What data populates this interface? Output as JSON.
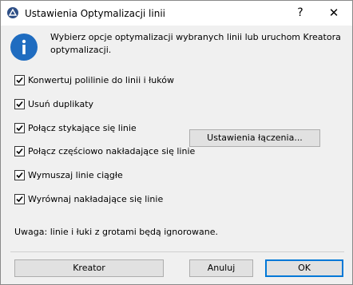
{
  "window": {
    "title": "Ustawienia Optymalizacji linii",
    "help_label": "?",
    "close_label": "✕"
  },
  "intro": {
    "icon": "info-icon",
    "text": "Wybierz opcje optymalizacji wybranych linii lub uruchom Kreatora optymalizacji."
  },
  "options": [
    {
      "label": "Konwertuj polilinie do linii i łuków",
      "checked": true
    },
    {
      "label": "Usuń duplikaty",
      "checked": true
    },
    {
      "label": "Połącz stykające się linie",
      "checked": true
    },
    {
      "label": "Połącz częściowo nakładające się linie",
      "checked": true
    },
    {
      "label": "Wymuszaj linie ciągłe",
      "checked": true
    },
    {
      "label": "Wyrównaj nakładające się linie",
      "checked": true
    }
  ],
  "buttons": {
    "connect_settings": "Ustawienia łączenia...",
    "wizard": "Kreator",
    "cancel": "Anuluj",
    "ok": "OK"
  },
  "note": "Uwaga: linie i łuki z grotami będą ignorowane."
}
